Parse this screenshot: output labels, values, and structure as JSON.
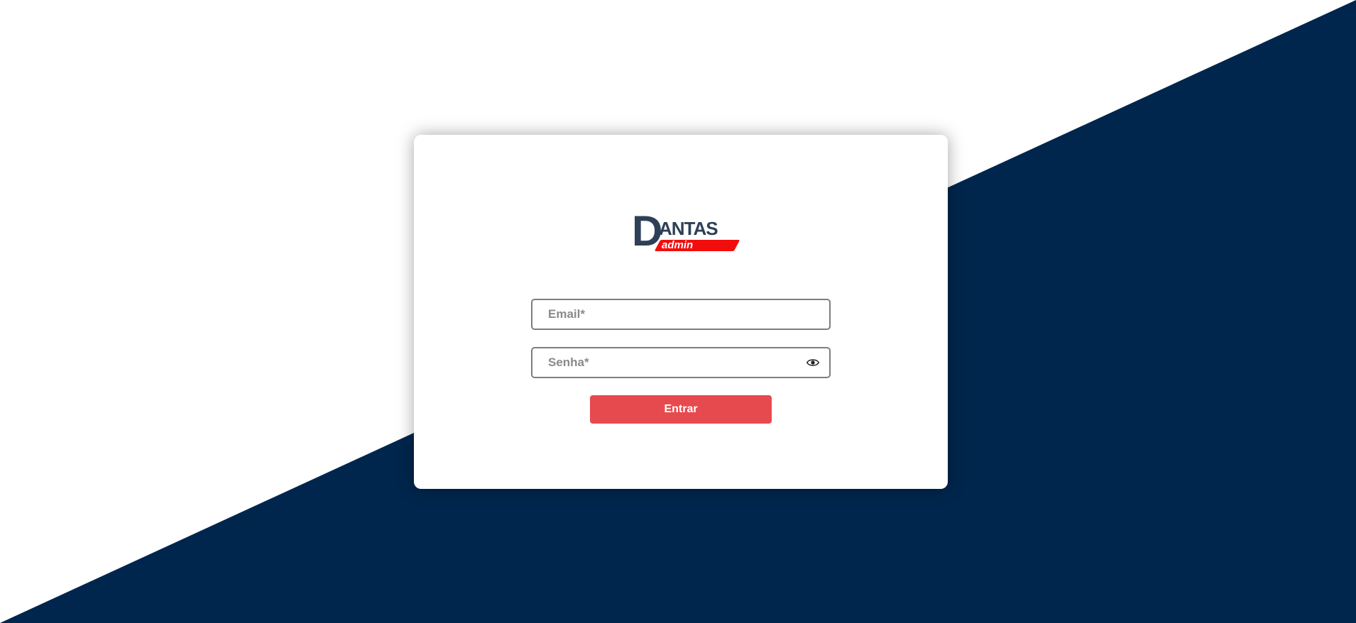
{
  "theme": {
    "background_dark": "#00264d",
    "background_light": "#ffffff",
    "accent": "#e74a4e",
    "logo_text_color": "#2e4057",
    "logo_stripe_color": "#f20d0d"
  },
  "logo": {
    "initial": "D",
    "rest": "ANTAS",
    "subtitle": "admin"
  },
  "form": {
    "email": {
      "placeholder": "Email*",
      "value": ""
    },
    "password": {
      "placeholder": "Senha*",
      "value": "",
      "toggle_icon": "eye-icon"
    },
    "submit_label": "Entrar"
  }
}
